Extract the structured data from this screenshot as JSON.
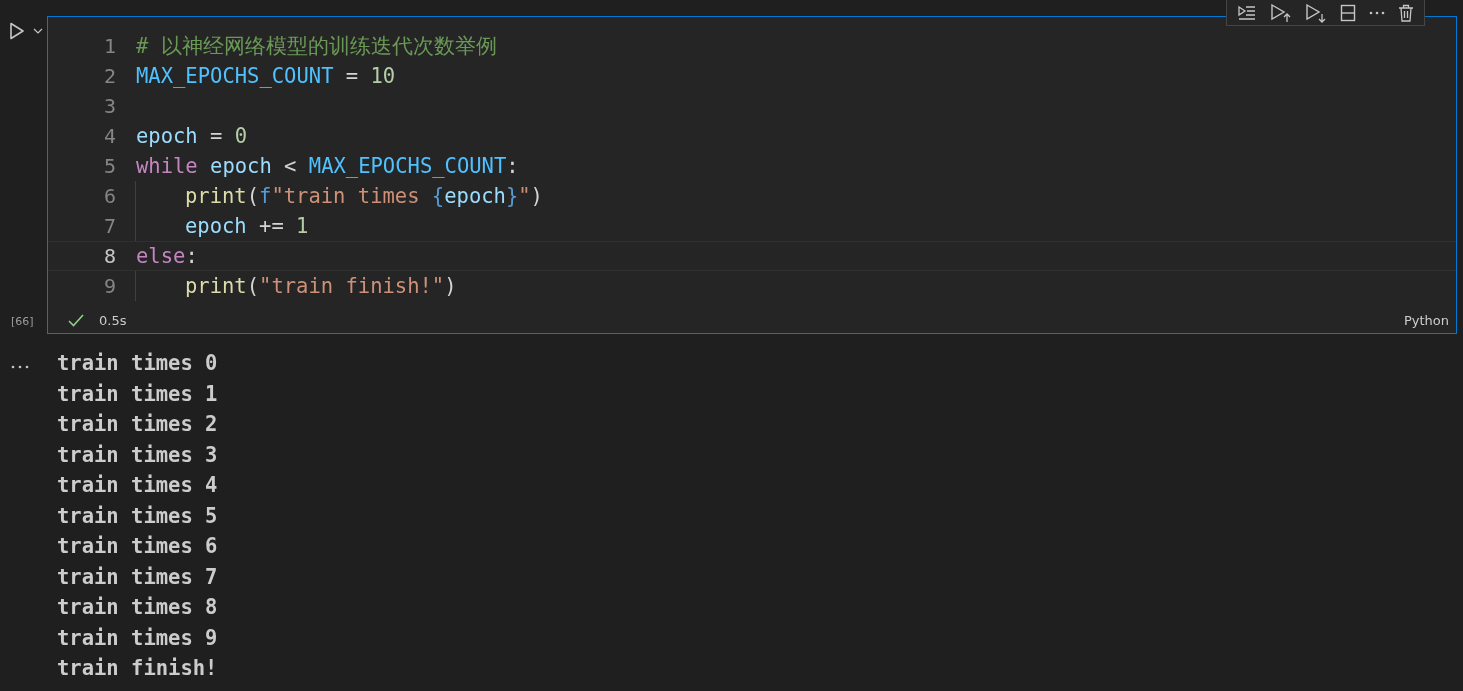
{
  "cell": {
    "execution_count": "[66]",
    "succeeded": true,
    "duration": "0.5s",
    "language": "Python",
    "lines": [
      {
        "number": "1",
        "current": false,
        "indented": false,
        "tokens": [
          {
            "kind": "comment",
            "text": "# 以神经网络模型的训练迭代次数举例"
          }
        ]
      },
      {
        "number": "2",
        "current": false,
        "indented": false,
        "tokens": [
          {
            "kind": "const",
            "text": "MAX_EPOCHS_COUNT"
          },
          {
            "kind": "op",
            "text": " = "
          },
          {
            "kind": "number",
            "text": "10"
          }
        ]
      },
      {
        "number": "3",
        "current": false
      },
      {
        "number": "4",
        "current": false,
        "indented": false,
        "tokens": [
          {
            "kind": "var",
            "text": "epoch"
          },
          {
            "kind": "op",
            "text": " = "
          },
          {
            "kind": "number",
            "text": "0"
          }
        ]
      },
      {
        "number": "5",
        "current": false,
        "indented": false,
        "tokens": [
          {
            "kind": "keyword",
            "text": "while "
          },
          {
            "kind": "var",
            "text": "epoch"
          },
          {
            "kind": "op",
            "text": " < "
          },
          {
            "kind": "const",
            "text": "MAX_EPOCHS_COUNT"
          },
          {
            "kind": "op",
            "text": ":"
          }
        ]
      },
      {
        "number": "6",
        "current": false,
        "indented": true,
        "tokens": [
          {
            "kind": "func",
            "text": "print"
          },
          {
            "kind": "op",
            "text": "("
          },
          {
            "kind": "brace",
            "text": "f"
          },
          {
            "kind": "string",
            "text": "\"train times "
          },
          {
            "kind": "brace",
            "text": "{"
          },
          {
            "kind": "var",
            "text": "epoch"
          },
          {
            "kind": "brace",
            "text": "}"
          },
          {
            "kind": "string",
            "text": "\""
          },
          {
            "kind": "op",
            "text": ")"
          }
        ]
      },
      {
        "number": "7",
        "current": false,
        "indented": true,
        "tokens": [
          {
            "kind": "var",
            "text": "epoch"
          },
          {
            "kind": "op",
            "text": " += "
          },
          {
            "kind": "number",
            "text": "1"
          }
        ]
      },
      {
        "number": "8",
        "current": true,
        "indented": false,
        "tokens": [
          {
            "kind": "keyword",
            "text": "else"
          },
          {
            "kind": "op",
            "text": ":"
          }
        ]
      },
      {
        "number": "9",
        "current": false,
        "indented": true,
        "tokens": [
          {
            "kind": "func",
            "text": "print"
          },
          {
            "kind": "op",
            "text": "("
          },
          {
            "kind": "string",
            "text": "\"train finish!\""
          },
          {
            "kind": "op",
            "text": ")"
          }
        ]
      }
    ]
  },
  "output": {
    "lines": [
      "train times 0",
      "train times 1",
      "train times 2",
      "train times 3",
      "train times 4",
      "train times 5",
      "train times 6",
      "train times 7",
      "train times 8",
      "train times 9",
      "train finish!"
    ]
  }
}
